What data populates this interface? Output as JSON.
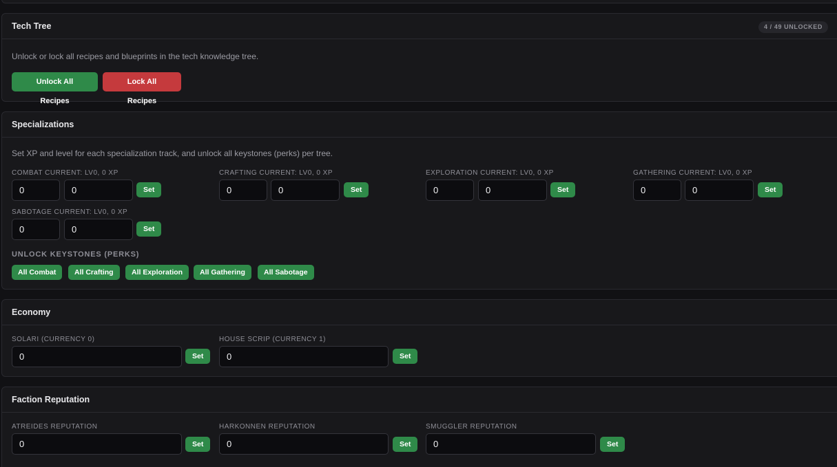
{
  "tech_tree": {
    "title": "Tech Tree",
    "badge": "4 / 49 UNLOCKED",
    "description": "Unlock or lock all recipes and blueprints in the tech knowledge tree.",
    "unlock_label": "Unlock All Recipes",
    "lock_label": "Lock All Recipes"
  },
  "specializations": {
    "title": "Specializations",
    "description": "Set XP and level for each specialization track, and unlock all keystones (perks) per tree.",
    "tracks": [
      {
        "label": "COMBAT CURRENT: LV0, 0 XP",
        "level": "0",
        "xp": "0",
        "set_label": "Set"
      },
      {
        "label": "CRAFTING CURRENT: LV0, 0 XP",
        "level": "0",
        "xp": "0",
        "set_label": "Set"
      },
      {
        "label": "EXPLORATION CURRENT: LV0, 0 XP",
        "level": "0",
        "xp": "0",
        "set_label": "Set"
      },
      {
        "label": "GATHERING CURRENT: LV0, 0 XP",
        "level": "0",
        "xp": "0",
        "set_label": "Set"
      },
      {
        "label": "SABOTAGE CURRENT: LV0, 0 XP",
        "level": "0",
        "xp": "0",
        "set_label": "Set"
      }
    ],
    "keystones_label": "UNLOCK KEYSTONES (PERKS)",
    "keystones": [
      "All Combat",
      "All Crafting",
      "All Exploration",
      "All Gathering",
      "All Sabotage"
    ]
  },
  "economy": {
    "title": "Economy",
    "currencies": [
      {
        "label": "SOLARI (CURRENCY 0)",
        "value": "0",
        "set_label": "Set"
      },
      {
        "label": "HOUSE SCRIP (CURRENCY 1)",
        "value": "0",
        "set_label": "Set"
      }
    ]
  },
  "reputation": {
    "title": "Faction Reputation",
    "factions": [
      {
        "label": "ATREIDES REPUTATION",
        "value": "0",
        "set_label": "Set"
      },
      {
        "label": "HARKONNEN REPUTATION",
        "value": "0",
        "set_label": "Set"
      },
      {
        "label": "SMUGGLER REPUTATION",
        "value": "0",
        "set_label": "Set"
      }
    ]
  },
  "colors": {
    "background": "#111114",
    "panel": "#18181b",
    "accent_green": "#2f8a49",
    "accent_red": "#c53a3d"
  }
}
